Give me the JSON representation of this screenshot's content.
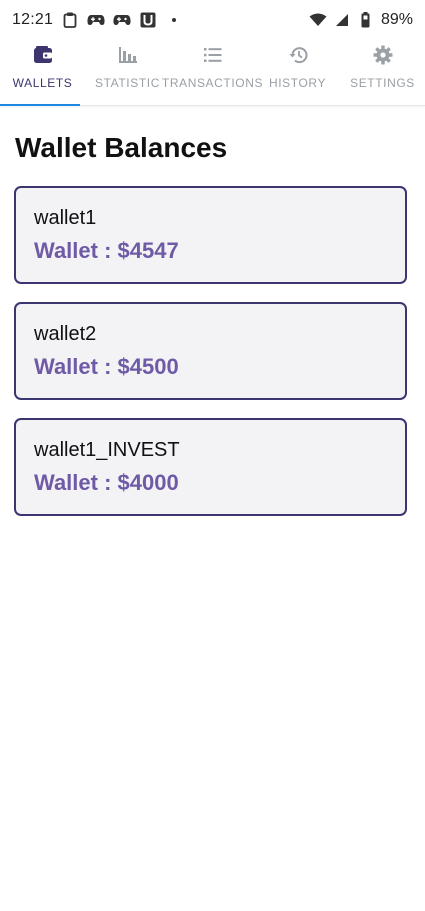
{
  "status_bar": {
    "time": "12:21",
    "battery": "89%",
    "icons": [
      "clipboard-icon",
      "game-controller-icon",
      "game-controller-icon",
      "u-icon",
      "dot-icon",
      "wifi-icon",
      "signal-icon",
      "battery-icon"
    ]
  },
  "tabs": [
    {
      "label": "WALLETS",
      "icon": "wallet-icon",
      "active": true
    },
    {
      "label": "STATISTIC",
      "icon": "bar-chart-icon",
      "active": false
    },
    {
      "label": "TRANSACTIONS",
      "icon": "list-icon",
      "active": false
    },
    {
      "label": "HISTORY",
      "icon": "history-icon",
      "active": false
    },
    {
      "label": "SETTINGS",
      "icon": "gear-icon",
      "active": false
    }
  ],
  "main": {
    "title": "Wallet Balances",
    "wallets": [
      {
        "name": "wallet1",
        "balance": "Wallet : $4547"
      },
      {
        "name": "wallet2",
        "balance": "Wallet : $4500"
      },
      {
        "name": "wallet1_INVEST",
        "balance": "Wallet : $4000"
      }
    ]
  },
  "colors": {
    "accent": "#3b3670",
    "balance": "#6f5aa6",
    "tab_inactive": "#9aa0a6",
    "indicator": "#1e88e5",
    "card_bg": "#f3f3f6"
  }
}
